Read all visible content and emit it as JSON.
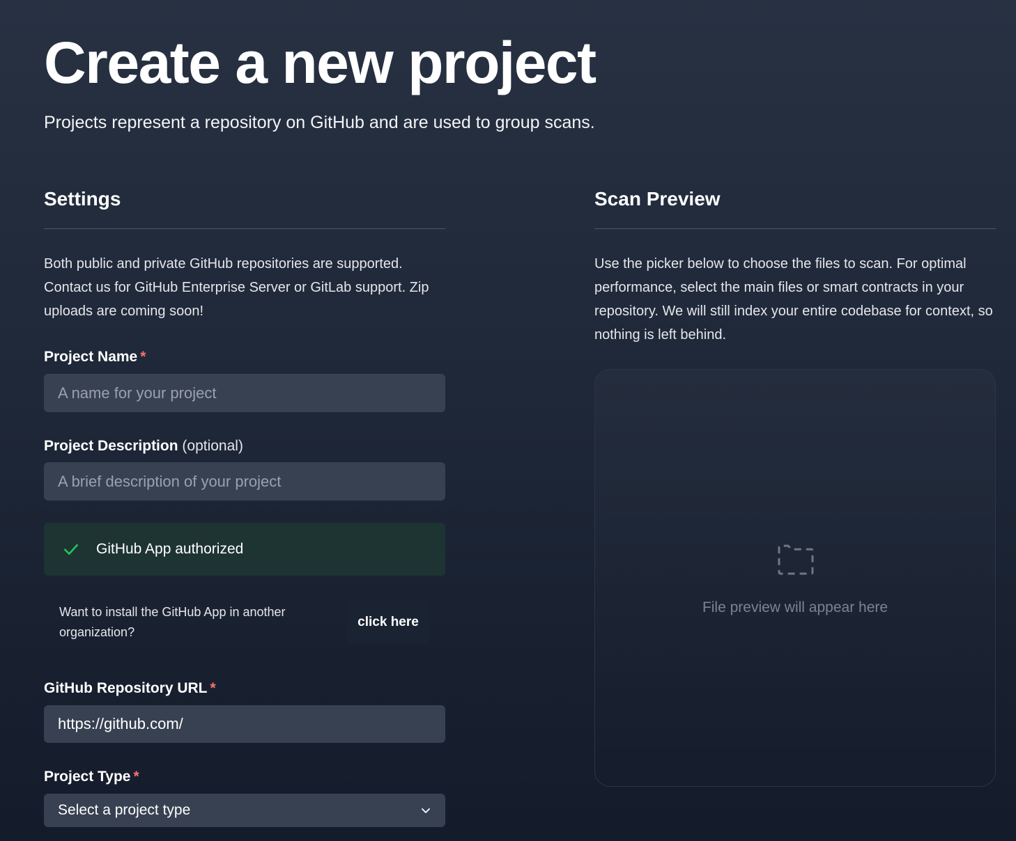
{
  "header": {
    "title": "Create a new project",
    "subtitle": "Projects represent a repository on GitHub and are used to group scans."
  },
  "settings": {
    "heading": "Settings",
    "intro": "Both public and private GitHub repositories are supported. Contact us for GitHub Enterprise Server or GitLab support. Zip uploads are coming soon!",
    "required_marker": "*",
    "project_name": {
      "label": "Project Name",
      "placeholder": "A name for your project"
    },
    "project_description": {
      "label": "Project Description",
      "optional_note": "(optional)",
      "placeholder": "A brief description of your project"
    },
    "github_auth": {
      "status_text": "GitHub App authorized",
      "status_color": "#22c55e",
      "install_prompt": "Want to install the GitHub App in another organization?",
      "install_link": "click here"
    },
    "repo_url": {
      "label": "GitHub Repository URL",
      "value": "https://github.com/"
    },
    "project_type": {
      "label": "Project Type",
      "selected": "Select a project type"
    }
  },
  "scan_preview": {
    "heading": "Scan Preview",
    "intro": "Use the picker below to choose the files to scan. For optimal performance, select the main files or smart contracts in your repository. We will still index your entire codebase for context, so nothing is left behind.",
    "empty_icon": "folder-dashed-icon",
    "empty_text": "File preview will appear here"
  }
}
